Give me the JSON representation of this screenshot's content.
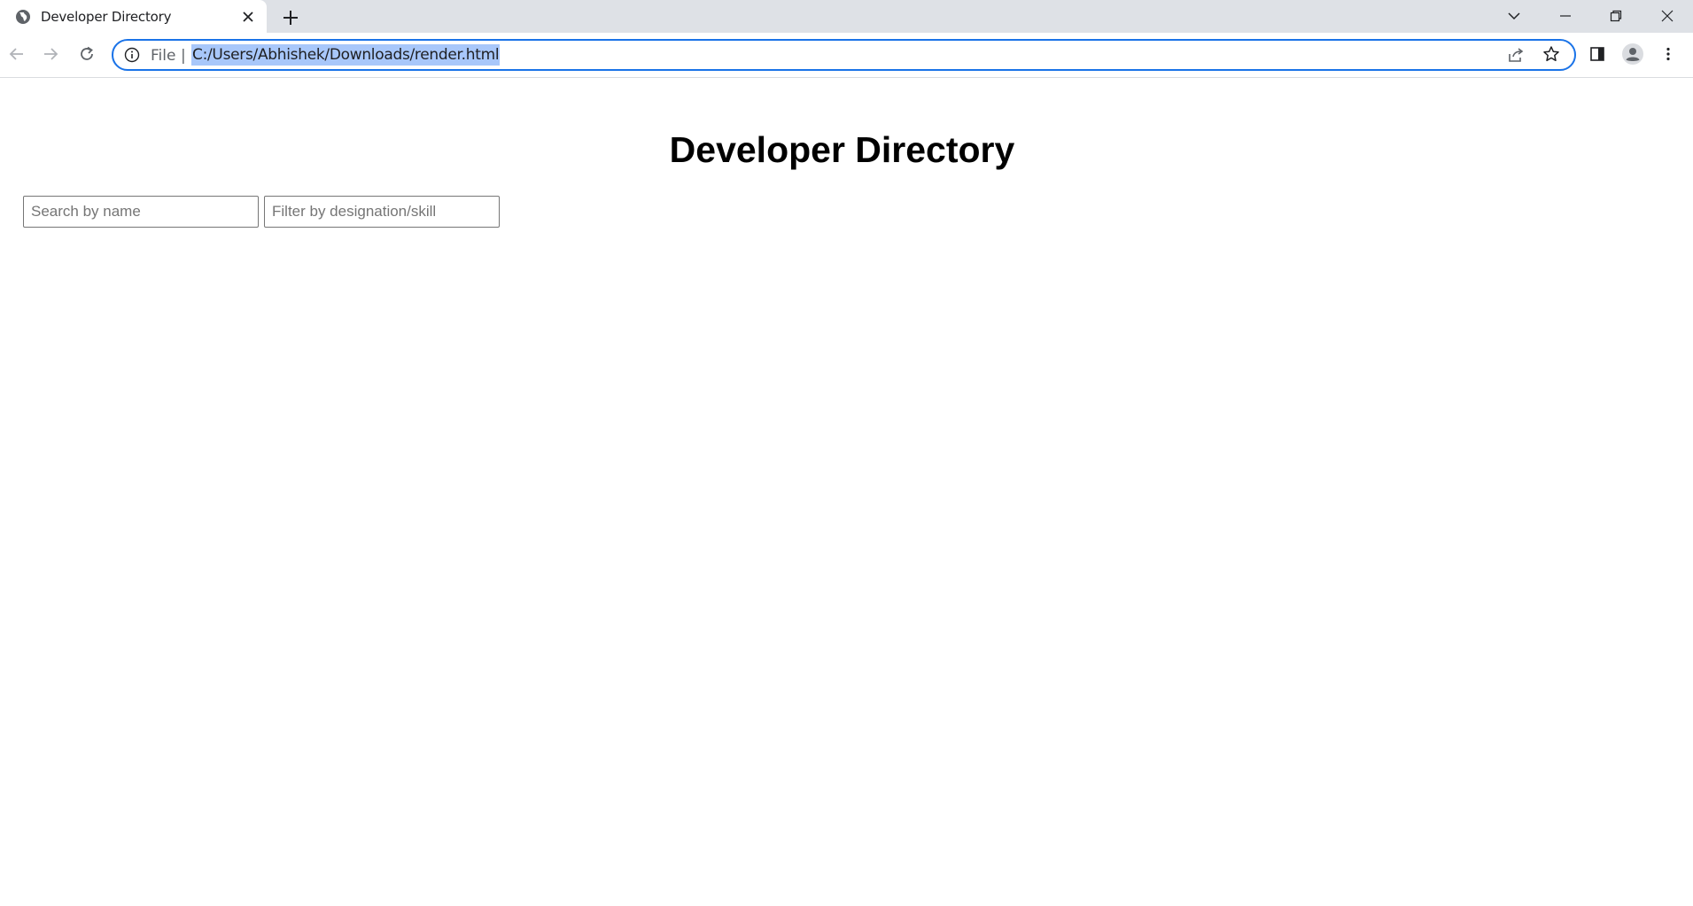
{
  "browser": {
    "tab": {
      "title": "Developer Directory"
    },
    "omnibox": {
      "scheme": "File",
      "separator": "|",
      "url": "C:/Users/Abhishek/Downloads/render.html"
    },
    "icons": {
      "favicon": "globe-icon",
      "close": "close-icon",
      "new_tab": "plus-icon",
      "back": "arrow-left-icon",
      "forward": "arrow-right-icon",
      "reload": "reload-icon",
      "info": "info-icon",
      "share": "share-icon",
      "bookmark": "star-icon",
      "side_panel": "side-panel-icon",
      "profile": "profile-icon",
      "menu": "more-vert-icon"
    },
    "colors": {
      "focus_ring": "#1a73e8",
      "url_selection": "#a8c7fa",
      "frame": "#dee1e6"
    }
  },
  "page": {
    "heading": "Developer Directory",
    "search": {
      "placeholder": "Search by name",
      "value": ""
    },
    "filter": {
      "placeholder": "Filter by designation/skill",
      "value": ""
    }
  }
}
